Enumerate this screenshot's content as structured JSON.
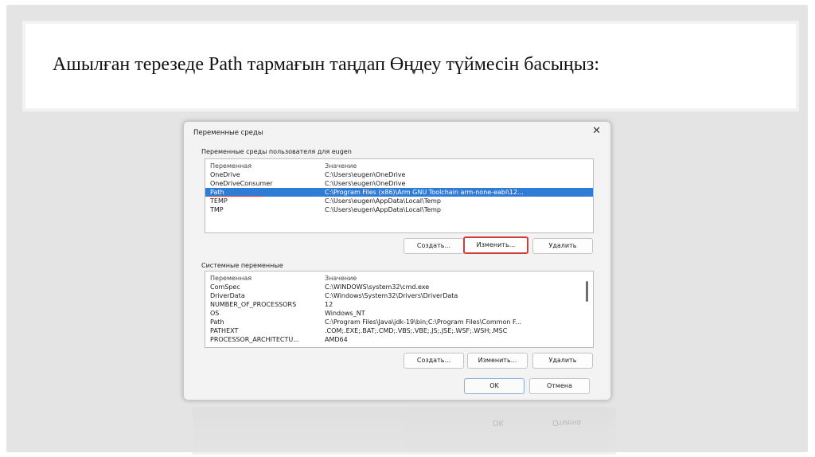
{
  "slide": {
    "title": "Ашылған терезеде Path тармағын таңдап Өңдеу түймесін басыңыз:"
  },
  "dialog": {
    "title": "Переменные среды",
    "close_glyph": "✕",
    "user_section": {
      "label": "Переменные среды пользователя для eugen",
      "header": [
        "Переменная",
        "Значение"
      ],
      "rows": [
        {
          "name": "OneDrive",
          "value": "C:\\Users\\eugen\\OneDrive"
        },
        {
          "name": "OneDriveConsumer",
          "value": "C:\\Users\\eugen\\OneDrive"
        },
        {
          "name": "Path",
          "value": "C:\\Program Files (x86)\\Arm GNU Toolchain arm-none-eabi\\12...",
          "selected": true
        },
        {
          "name": "TEMP",
          "value": "C:\\Users\\eugen\\AppData\\Local\\Temp"
        },
        {
          "name": "TMP",
          "value": "C:\\Users\\eugen\\AppData\\Local\\Temp"
        }
      ],
      "buttons": {
        "create": "Создать...",
        "edit": "Изменить...",
        "delete": "Удалить"
      }
    },
    "system_section": {
      "label": "Системные переменные",
      "header": [
        "Переменная",
        "Значение"
      ],
      "rows": [
        {
          "name": "ComSpec",
          "value": "C:\\WINDOWS\\system32\\cmd.exe"
        },
        {
          "name": "DriverData",
          "value": "C:\\Windows\\System32\\Drivers\\DriverData"
        },
        {
          "name": "NUMBER_OF_PROCESSORS",
          "value": "12"
        },
        {
          "name": "OS",
          "value": "Windows_NT"
        },
        {
          "name": "Path",
          "value": "C:\\Program Files\\Java\\jdk-19\\bin;C:\\Program Files\\Common F..."
        },
        {
          "name": "PATHEXT",
          "value": ".COM;.EXE;.BAT;.CMD;.VBS;.VBE;.JS;.JSE;.WSF;.WSH;.MSC"
        },
        {
          "name": "PROCESSOR_ARCHITECTU...",
          "value": "AMD64"
        }
      ],
      "buttons": {
        "create": "Создать...",
        "edit": "Изменить...",
        "delete": "Удалить"
      }
    },
    "footer": {
      "ok": "OK",
      "cancel": "Отмена"
    }
  },
  "colors": {
    "selection": "#2f7bd6",
    "highlight_border": "#d23b3b",
    "slide_bg": "#e4e4e4"
  }
}
